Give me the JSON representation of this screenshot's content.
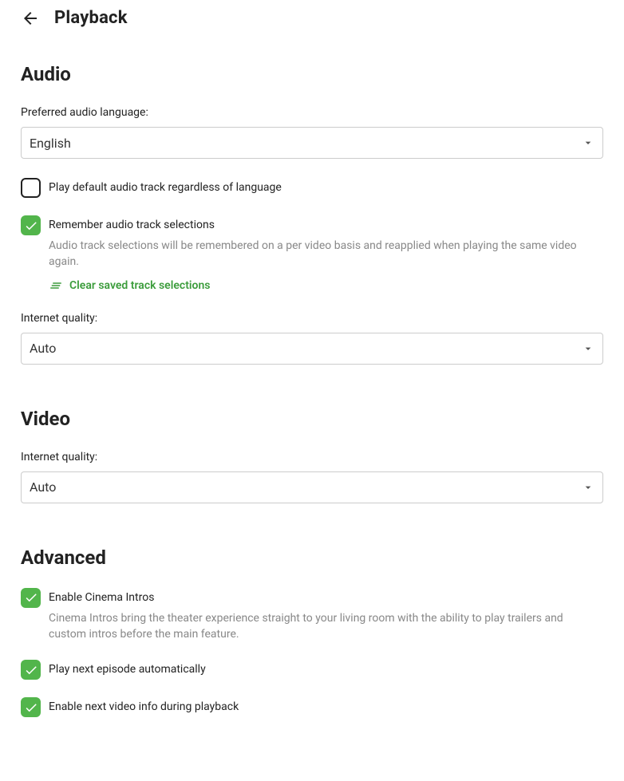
{
  "page": {
    "title": "Playback"
  },
  "sections": {
    "audio": {
      "title": "Audio",
      "preferredLanguage": {
        "label": "Preferred audio language:",
        "value": "English"
      },
      "playDefault": {
        "label": "Play default audio track regardless of language",
        "checked": false
      },
      "remember": {
        "label": "Remember audio track selections",
        "description": "Audio track selections will be remembered on a per video basis and reapplied when playing the same video again.",
        "checked": true,
        "clearLink": "Clear saved track selections"
      },
      "internetQuality": {
        "label": "Internet quality:",
        "value": "Auto"
      }
    },
    "video": {
      "title": "Video",
      "internetQuality": {
        "label": "Internet quality:",
        "value": "Auto"
      }
    },
    "advanced": {
      "title": "Advanced",
      "cinemaIntros": {
        "label": "Enable Cinema Intros",
        "description": "Cinema Intros bring the theater experience straight to your living room with the ability to play trailers and custom intros before the main feature.",
        "checked": true
      },
      "playNext": {
        "label": "Play next episode automatically",
        "checked": true
      },
      "nextInfo": {
        "label": "Enable next video info during playback",
        "checked": true
      }
    }
  }
}
